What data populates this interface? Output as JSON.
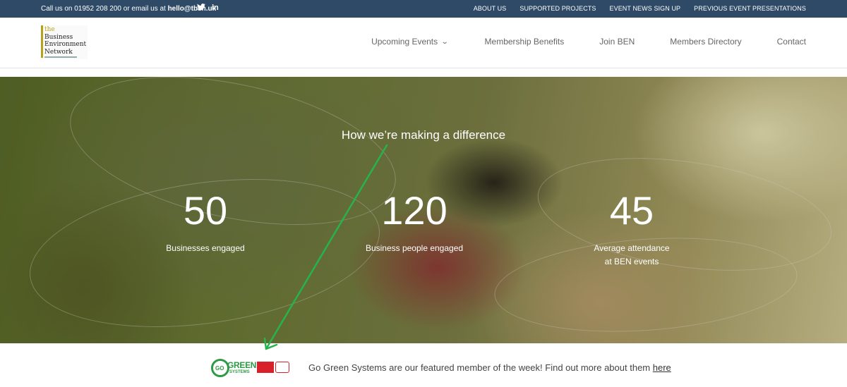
{
  "topbar": {
    "contact_prefix": "Call us on 01952 208 200 or email us at ",
    "email": "hello@tben.uk",
    "twitter_icon": "twitter-icon",
    "linkedin_icon": "linkedin-icon",
    "twitter_glyph": "🐦",
    "linkedin_glyph": "in",
    "links": [
      "ABOUT US",
      "SUPPORTED PROJECTS",
      "EVENT NEWS SIGN UP",
      "PREVIOUS EVENT PRESENTATIONS"
    ],
    "background": "#2e4a66"
  },
  "logo": {
    "line1": "the",
    "line2": "Business",
    "line3": "Environment",
    "line4": "Network",
    "accent": "#b5a21a"
  },
  "nav": {
    "items": [
      "Upcoming Events",
      "Membership Benefits",
      "Join BEN",
      "Members Directory",
      "Contact"
    ]
  },
  "hero": {
    "title": "How we’re making a difference",
    "stats": [
      {
        "value": "50",
        "label": "Businesses engaged"
      },
      {
        "value": "120",
        "label": "Business people engaged"
      },
      {
        "value": "45",
        "label": "Average attendance at BEN events"
      }
    ]
  },
  "featured": {
    "logo_circle_text": "GO",
    "logo_word": "GREEN",
    "logo_sub": "SYSTEMS",
    "text": "Go Green Systems are our featured member of the week! Find out more about them ",
    "link_text": "here",
    "brand_color": "#2f9a45"
  },
  "annotation": {
    "arrow_color": "#27b34b"
  }
}
